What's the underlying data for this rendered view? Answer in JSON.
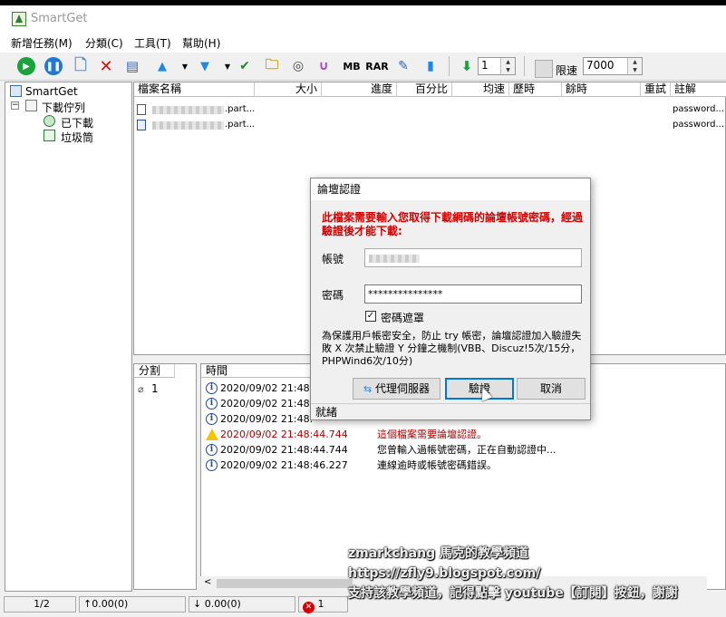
{
  "app": {
    "title": "SmartGet"
  },
  "menu": [
    "新增任務(M)",
    "分類(C)",
    "工具(T)",
    "幫助(H)"
  ],
  "toolbar": {
    "threads_value": "1",
    "limit_label": "限速",
    "limit_value": "7000",
    "mb_label": "MB",
    "rar_label": "RAR"
  },
  "tree": {
    "root": "SmartGet",
    "queue": "下載佇列",
    "done": "已下載",
    "trash": "垃圾筒"
  },
  "list": {
    "columns": [
      "檔案名稱",
      "大小",
      "進度",
      "百分比",
      "均速",
      "歷時",
      "餘時",
      "重試",
      "註解"
    ],
    "rows": [
      {
        "name_suffix": ".part...",
        "note": "password..."
      },
      {
        "name_suffix": ".part...",
        "note": "password..."
      }
    ]
  },
  "split": {
    "header": "分割",
    "row": "1"
  },
  "log": {
    "header": "時間",
    "rows": [
      {
        "time": "2020/09/02 21:48:",
        "msg": "",
        "type": "info"
      },
      {
        "time": "2020/09/02 21:48:",
        "msg": "",
        "type": "info"
      },
      {
        "time": "2020/09/02 21:48:",
        "msg": "",
        "type": "info"
      },
      {
        "time": "2020/09/02 21:48:44.744",
        "msg": "這個檔案需要論壇認證。",
        "type": "warn"
      },
      {
        "time": "2020/09/02 21:48:44.744",
        "msg": "您曾輸入過帳號密碼，正在自動認證中...",
        "type": "info"
      },
      {
        "time": "2020/09/02 21:48:46.227",
        "msg": "連線逾時或帳號密碼錯誤。",
        "type": "info"
      }
    ]
  },
  "status": {
    "count": "1/2",
    "up": "↑0.00(0)",
    "down": "↓ 0.00(0)",
    "errors": "1"
  },
  "dialog": {
    "title": "論壇認證",
    "warning": "此檔案需要輸入您取得下載網碼的論壇帳號密碼，經過驗證後才能下載:",
    "account_label": "帳號",
    "password_label": "密碼",
    "password_value": "***************",
    "mask_label": "密碼遮罩",
    "note": "為保護用戶帳密安全，防止 try 帳密，論壇認證加入驗證失敗 X 次禁止驗證 Y 分鐘之機制(VBB、Discuz!5次/15分，PHPWind6次/10分)",
    "proxy_button": "代理伺服器",
    "verify_button": "驗證",
    "cancel_button": "取消",
    "status": "就緒"
  },
  "watermark": {
    "line1": "zmarkchang 馬克的教學頻道",
    "line2": "https://zfly9.blogspot.com/",
    "line3": "支持該教學頻道，記得點擊 youtube【訂閱】按鈕，謝謝"
  }
}
